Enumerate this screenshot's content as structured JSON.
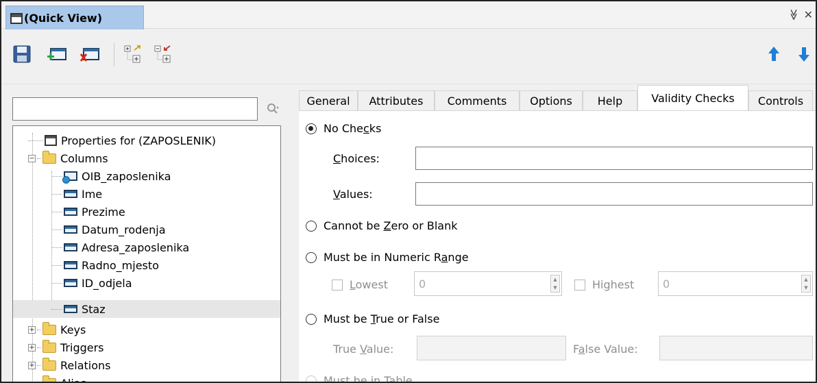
{
  "window": {
    "title": "(Quick View)",
    "controls": [
      "≫",
      "✕"
    ]
  },
  "toolbar": {
    "buttons": [
      "save-icon",
      "add-column-icon",
      "remove-column-icon",
      "expand-tree-icon",
      "collapse-tree-icon",
      "move-up-icon",
      "move-down-icon"
    ]
  },
  "search": {
    "value": ""
  },
  "tree": {
    "properties": "Properties for (ZAPOSLENIK)",
    "columns_label": "Columns",
    "columns": [
      "OIB_zaposlenika",
      "Ime",
      "Prezime",
      "Datum_rodenja",
      "Adresa_zaposlenika",
      "Radno_mjesto",
      "ID_odjela",
      "Staz"
    ],
    "groups": [
      "Keys",
      "Triggers",
      "Relations",
      "Alias"
    ]
  },
  "tabs": [
    "General",
    "Attributes",
    "Comments",
    "Options",
    "Help",
    "Validity Checks",
    "Controls"
  ],
  "active_tab": "Validity Checks",
  "validity": {
    "no_checks": {
      "pre": "No Che",
      "ul": "c",
      "post": "ks"
    },
    "choices": {
      "ul": "C",
      "post": "hoices:"
    },
    "values": {
      "ul": "V",
      "post": "alues:"
    },
    "zero_blank": {
      "pre": "Cannot be ",
      "ul": "Z",
      "post": "ero or Blank"
    },
    "numeric_range": {
      "pre": "Must be in Numeric R",
      "ul": "a",
      "post": "nge"
    },
    "lowest": {
      "ul": "L",
      "post": "owest"
    },
    "lowest_value": "0",
    "highest": {
      "pre": "Hi",
      "ul": "g",
      "post": "hest"
    },
    "highest_value": "0",
    "true_false": {
      "pre": "Must be ",
      "ul": "T",
      "post": "rue or False"
    },
    "true_value": {
      "pre": "True ",
      "ul": "V",
      "post": "alue:"
    },
    "false_value": {
      "pre": "F",
      "ul": "a",
      "post": "lse Value:"
    },
    "in_table": "Must be in Table"
  },
  "colors": {
    "title_tab": "#a9c8ea",
    "arrow_blue": "#1f7fd4"
  }
}
